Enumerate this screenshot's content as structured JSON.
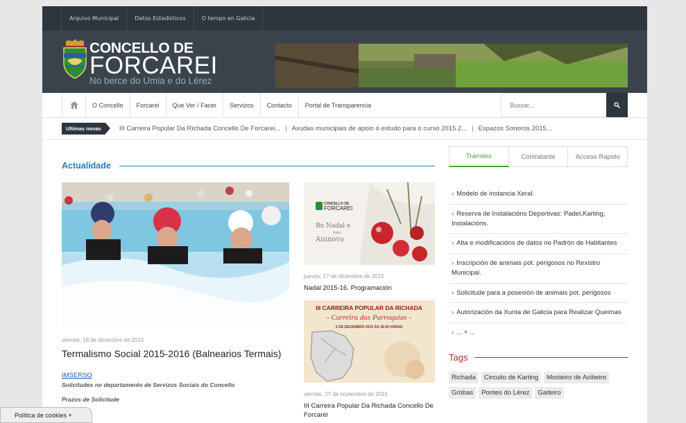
{
  "topbar": {
    "links": [
      "Arquivo Municipal",
      "Datos Estadísticos",
      "O tempo en Galicia"
    ]
  },
  "brand": {
    "line1": "CONCELLO DE",
    "line2": "FORCAREI",
    "tagline": "No berce do Umia e do Lérez"
  },
  "nav": {
    "items": [
      "O Concello",
      "Forcarei",
      "Que Ver / Facer",
      "Servizos",
      "Contacto",
      "Portal de Transparencia"
    ],
    "search_placeholder": "Buscar..."
  },
  "ticker": {
    "label": "Ultimas novas",
    "items": [
      "III Carreira Popular Da Richada Concello De Forcarei...",
      "Axudas municipais de apoio ó estudo para o curso 2015 2...",
      "Espazos Sonoros 2015..."
    ]
  },
  "main": {
    "section_title": "Actualidade",
    "featured": {
      "date": "viernes, 18 de diciembre de 2015",
      "title": "Termalismo Social 2015-2016 (Balnearios Termais)",
      "link": "IMSERSO",
      "excerpt": "Solicitudes no departamento de Servizos Sociais do Concello",
      "sub": "Prazos de Solicitude"
    },
    "posts": [
      {
        "date": "jueves, 17 de diciembre de 2015",
        "title": "Nadal 2015-16. Programación",
        "img_brand1": "CONCELLO DE",
        "img_brand2": "FORCAREI",
        "img_text1": "Bo Nadal e",
        "img_text2": "Feliz",
        "img_text3": "Aninovo"
      },
      {
        "date": "viernes, 27 de noviembre de 2015",
        "title": "III Carreira Popular Da Richada Concello De Forcarei",
        "img_text1": "III CARREIRA POPULAR DA RICHADA",
        "img_text2": "- Carreira das Parroquias -",
        "img_text3": "5 DE DECEMBRO 2015 ÁS 18:30 HORAS"
      }
    ]
  },
  "sidebar": {
    "tabs": [
      "Trámites",
      "Contratante",
      "Acceso Rápido"
    ],
    "items": [
      "Modelo de instancia Xeral.",
      "Reserva de Instalacións Deportivas: Padel,Karting, Instalacións.",
      "Alta e modificacións de datos no Padrón de Habitantes",
      "Inscripción de animais pot. perigosos no Rexistro Municipal.",
      "Solicitude para a posesión de animais pot. perigosos",
      "Autorización da Xunta de Galicia para Realizar Queimas",
      "... + ..."
    ],
    "tags_title": "Tags",
    "tags": [
      "Richada",
      "Circuito de Karting",
      "Mosteiro de Acibeiro",
      "Grobas",
      "Pontes do Lérez",
      "Gaiteiro"
    ]
  },
  "cookie": {
    "label": "Política de cookies +"
  },
  "colors": {
    "accent_blue": "#2a7ab8",
    "accent_green": "#4a9e3c",
    "accent_red": "#b22b2b",
    "dark": "#2f353c"
  }
}
